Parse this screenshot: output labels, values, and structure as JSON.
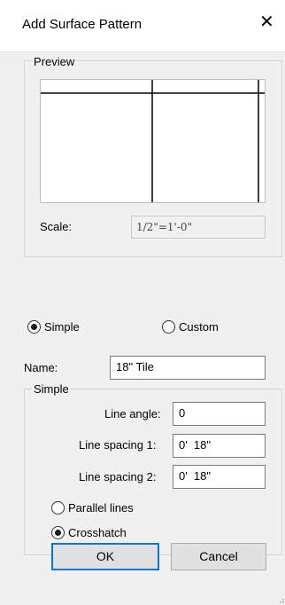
{
  "dialog": {
    "title": "Add Surface Pattern",
    "close_glyph": "✕"
  },
  "preview": {
    "legend": "Preview",
    "scale_label": "Scale:",
    "scale_value": "1/2\"=1'-0\""
  },
  "pattern_type": {
    "simple_label": "Simple",
    "custom_label": "Custom",
    "selected": "simple"
  },
  "name": {
    "label": "Name:",
    "value": "18\" Tile"
  },
  "simple_group": {
    "legend": "Simple",
    "line_angle_label": "Line angle:",
    "line_angle_value": "0",
    "line_spacing_1_label": "Line spacing 1:",
    "line_spacing_1_value": "0'  18\"",
    "line_spacing_2_label": "Line spacing 2:",
    "line_spacing_2_value": "0'  18\"",
    "parallel_label": "Parallel lines",
    "crosshatch_label": "Crosshatch",
    "selected": "crosshatch"
  },
  "buttons": {
    "ok": "OK",
    "cancel": "Cancel"
  },
  "colors": {
    "accent": "#0078d7",
    "window_bg": "#f0f0f0"
  }
}
